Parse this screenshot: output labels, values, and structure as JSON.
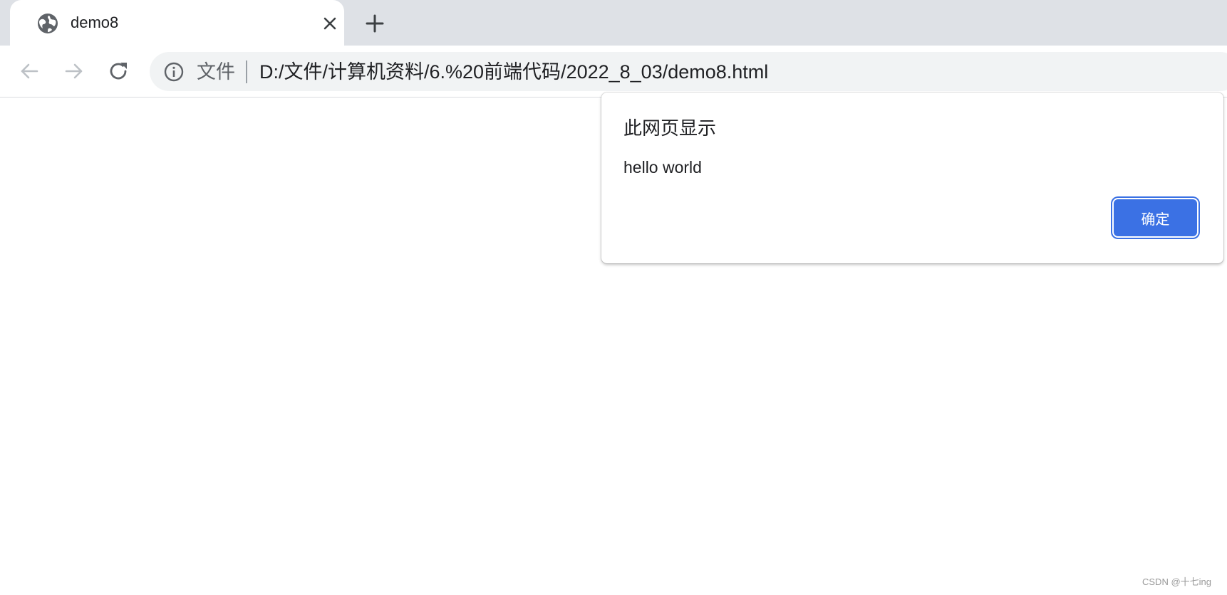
{
  "browser": {
    "tab": {
      "title": "demo8",
      "favicon": "globe-icon",
      "close_icon": "close-icon"
    },
    "new_tab_icon": "plus-icon",
    "nav": {
      "back_icon": "arrow-left-icon",
      "forward_icon": "arrow-right-icon",
      "reload_icon": "reload-icon"
    },
    "omnibox": {
      "info_icon": "info-icon",
      "scheme_label": "文件",
      "url": "D:/文件/计算机资料/6.%20前端代码/2022_8_03/demo8.html"
    }
  },
  "dialog": {
    "title": "此网页显示",
    "message": "hello world",
    "ok_label": "确定",
    "accent_color": "#3b71e4"
  },
  "watermark": "CSDN @十七ing"
}
